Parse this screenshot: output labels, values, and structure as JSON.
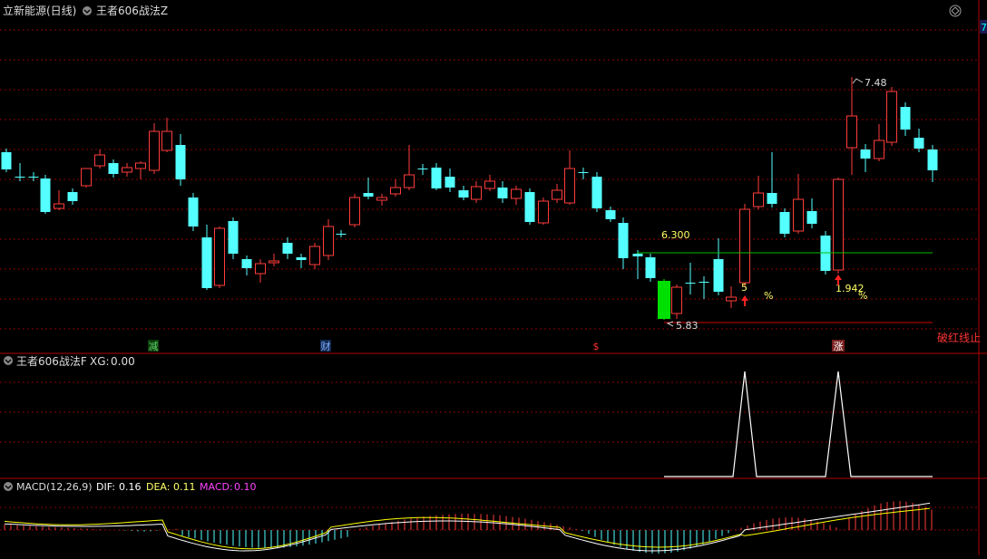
{
  "header": {
    "stock_title": "立新能源(日线)",
    "indicator_title": "王者606战法Z",
    "right_edge_tab": "7"
  },
  "main_panel": {
    "annotations": {
      "high_label": "7.48",
      "low_label": "5.83",
      "level_label": "6.300",
      "pct1_value": "5",
      "pct1_sign": "%",
      "pct2_value": "1.942",
      "pct2_sign": "%",
      "break_text": "破红线止"
    },
    "markers": [
      {
        "text": "减",
        "color": "#5fd36b"
      },
      {
        "text": "财",
        "color": "#4a86e8"
      },
      {
        "text": "$",
        "color": "#ff3333"
      },
      {
        "text": "涨",
        "color": "#ff5555"
      }
    ]
  },
  "xg_panel": {
    "name": "王者606战法F",
    "field": "XG:",
    "value": "0.00"
  },
  "macd_panel": {
    "name": "MACD(12,26,9)",
    "dif_label": "DIF:",
    "dif_value": "0.16",
    "dea_label": "DEA:",
    "dea_value": "0.11",
    "macd_label": "MACD:",
    "macd_value": "0.10"
  },
  "colors": {
    "up": "#ff3c3c",
    "down": "#54ffff",
    "limit_down": "#00e000",
    "dif": "#ffffff",
    "dea": "#ffff00",
    "macd_value": "#ff44ff",
    "grid": "#8b0000",
    "panel_border": "#b00000",
    "level_line": "#00c000",
    "red_line": "#d00000"
  },
  "icons": [
    "chevron-down-icon",
    "diamond-toggle-icon",
    "up-arrow-icon"
  ]
}
